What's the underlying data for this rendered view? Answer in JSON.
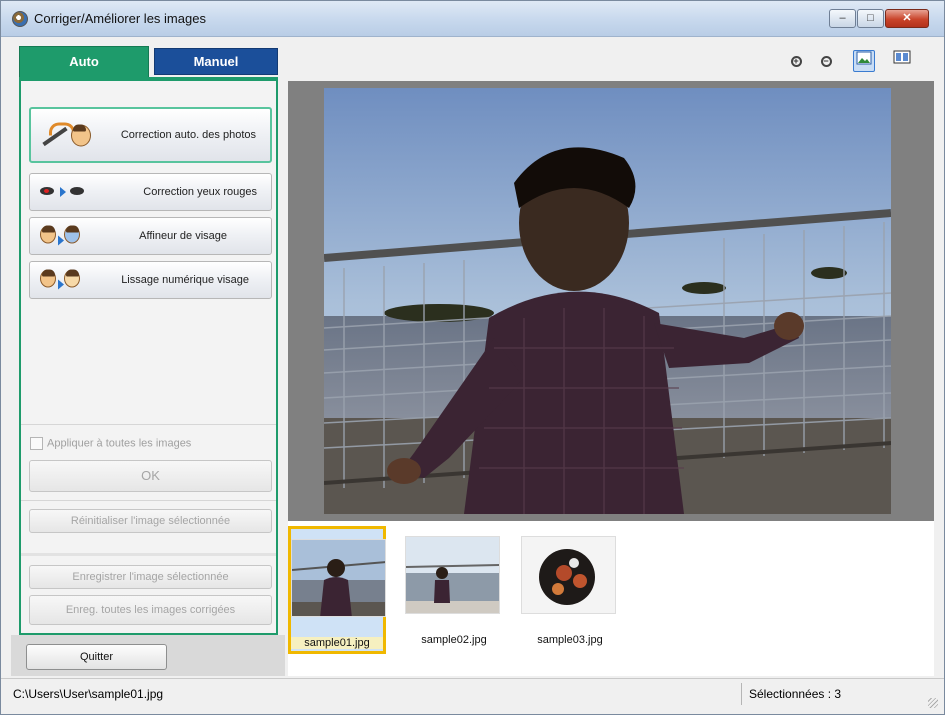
{
  "window": {
    "title": "Corriger/Améliorer les images",
    "controls": {
      "minimize": "–",
      "maximize": "□",
      "close": "✕"
    }
  },
  "tabs": [
    {
      "label": "Auto",
      "active": true
    },
    {
      "label": "Manuel",
      "active": false
    }
  ],
  "auto_panel": {
    "buttons": [
      {
        "label": "Correction auto. des photos",
        "icon": "magic-wand-icon"
      },
      {
        "label": "Correction yeux rouges",
        "icon": "red-eye-icon"
      },
      {
        "label": "Affineur de visage",
        "icon": "face-sharpen-icon"
      },
      {
        "label": "Lissage numérique visage",
        "icon": "face-smooth-icon"
      }
    ],
    "apply_all_label": "Appliquer à toutes les images",
    "apply_all_checked": false,
    "ok_label": "OK",
    "reset_label": "Réinitialiser l'image sélectionnée",
    "save_selected_label": "Enregistrer l'image sélectionnée",
    "save_all_label": "Enreg. toutes les images corrigées"
  },
  "quit_label": "Quitter",
  "toolbar": {
    "zoom_in_icon": "zoom-in-icon",
    "zoom_out_icon": "zoom-out-icon",
    "view_whole_icon": "whole-image-view-icon",
    "compare_view_icon": "compare-view-icon",
    "active_view": "whole-image"
  },
  "thumbnails": [
    {
      "filename": "sample01.jpg",
      "selected": true
    },
    {
      "filename": "sample02.jpg",
      "selected": false
    },
    {
      "filename": "sample03.jpg",
      "selected": false
    }
  ],
  "status": {
    "path": "C:\\Users\\User\\sample01.jpg",
    "selected_count": "Sélectionnées : 3"
  },
  "colors": {
    "auto_tab": "#1e9b6b",
    "manuel_tab": "#1b4f9a",
    "selection": "#f0b800"
  }
}
